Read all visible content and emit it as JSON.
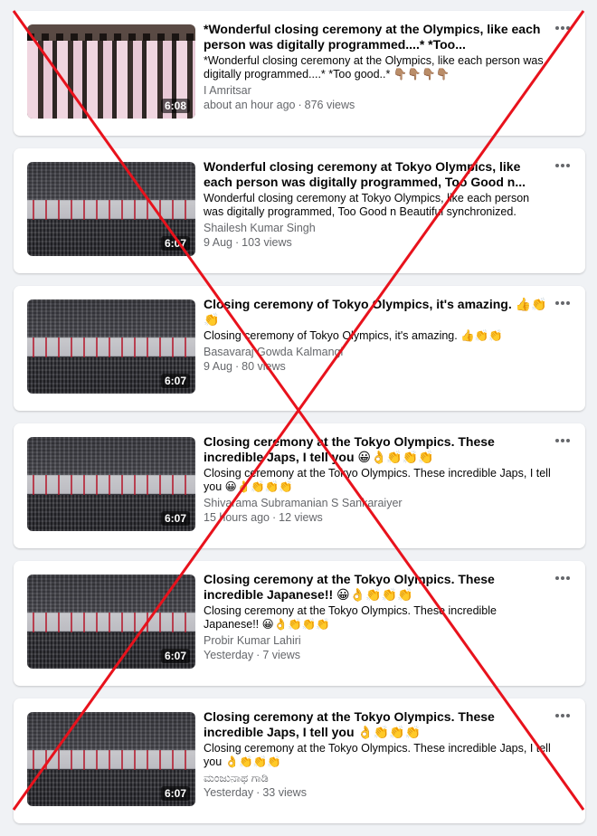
{
  "videos": [
    {
      "title": "*Wonderful closing ceremony at the Olympics, like each person was digitally programmed....* *Too...",
      "description": "*Wonderful closing ceremony at the Olympics, like each person was digitally programmed....* *Too good..* 👇🏽👇🏽👇🏽👇🏽",
      "author": "I Amritsar",
      "time": "about an hour ago",
      "views": "876 views",
      "duration": "6:08",
      "thumb": "people"
    },
    {
      "title": "Wonderful closing ceremony at Tokyo Olympics, like each person was digitally programmed, Too Good n...",
      "description": "Wonderful closing ceremony at Tokyo Olympics, like each person was digitally programmed, Too Good n Beautiful synchronized.",
      "author": "Shailesh Kumar Singh",
      "time": "9 Aug",
      "views": "103 views",
      "duration": "6:07",
      "thumb": "stadium"
    },
    {
      "title": "Closing ceremony of Tokyo Olympics, it's amazing. 👍👏👏",
      "description": "Closing ceremony of Tokyo Olympics, it's amazing. 👍👏👏",
      "author": "Basavaraj Gowda Kalmangi",
      "time": "9 Aug",
      "views": "80 views",
      "duration": "6:07",
      "thumb": "stadium"
    },
    {
      "title": "Closing ceremony at the Tokyo Olympics. These incredible Japs, I tell you 😀👌👏👏👏",
      "description": "Closing ceremony at the Tokyo Olympics. These incredible Japs, I tell you 😀👌👏👏👏",
      "author": "Shivarama Subramanian S Sankaraiyer",
      "time": "15 hours ago",
      "views": "12 views",
      "duration": "6:07",
      "thumb": "stadium"
    },
    {
      "title": "Closing ceremony at the Tokyo Olympics. These incredible Japanese!! 😀👌👏👏👏",
      "description": "Closing ceremony at the Tokyo Olympics. These incredible Japanese!! 😀👌👏👏👏",
      "author": "Probir Kumar Lahiri",
      "time": "Yesterday",
      "views": "7 views",
      "duration": "6:07",
      "thumb": "stadium"
    },
    {
      "title": "Closing ceremony at the Tokyo Olympics. These incredible Japs, I tell you 👌👏👏👏",
      "description": "Closing ceremony at the Tokyo Olympics. These incredible Japs, I tell you 👌👏👏👏",
      "author": "ಮಂಜುನಾಥ ಗಾಡಿ",
      "time": "Yesterday",
      "views": "33 views",
      "duration": "6:07",
      "thumb": "stadium"
    }
  ],
  "more_icon": "more-horizontal-icon",
  "overlay": {
    "type": "red-x-mark",
    "color": "#e8121c"
  },
  "colors": {
    "background": "#f0f2f5",
    "card": "#ffffff",
    "secondary_text": "#65676b"
  }
}
